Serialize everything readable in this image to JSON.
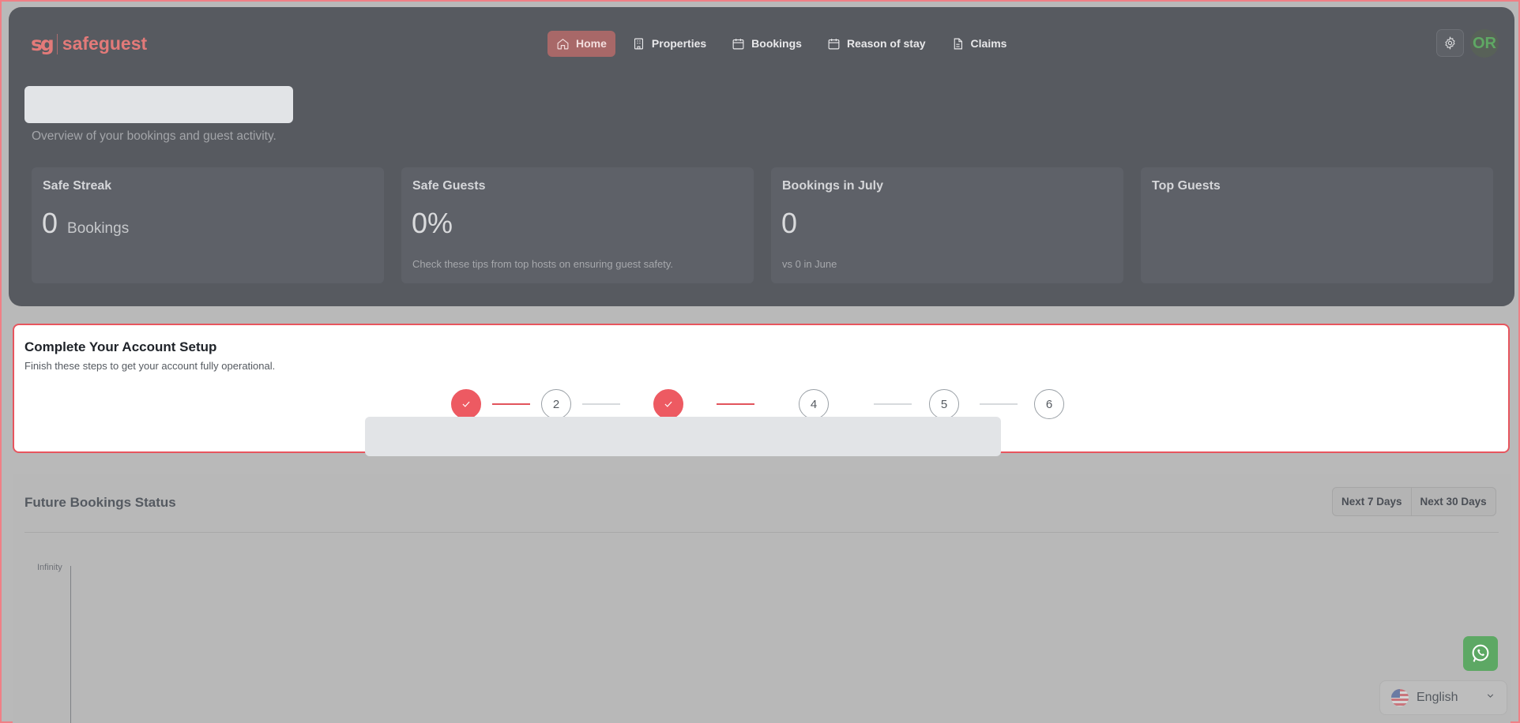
{
  "brand": {
    "name": "safeguest",
    "mark": "sg"
  },
  "nav": {
    "items": [
      {
        "label": "Home",
        "icon": "home-icon"
      },
      {
        "label": "Properties",
        "icon": "building-icon"
      },
      {
        "label": "Bookings",
        "icon": "calendar-icon"
      },
      {
        "label": "Reason of stay",
        "icon": "calendar-icon"
      },
      {
        "label": "Claims",
        "icon": "document-icon"
      }
    ]
  },
  "user": {
    "initials": "OR"
  },
  "page": {
    "subtitle": "Overview of your bookings and guest activity."
  },
  "stats": [
    {
      "title": "Safe Streak",
      "value": "0",
      "unit": "Bookings",
      "note": ""
    },
    {
      "title": "Safe Guests",
      "value": "0%",
      "unit": "",
      "note": "Check these tips from top hosts on ensuring guest safety."
    },
    {
      "title": "Bookings in July",
      "value": "0",
      "unit": "",
      "note": "vs 0 in June"
    },
    {
      "title": "Top Guests",
      "value": "",
      "unit": "",
      "note": ""
    }
  ],
  "setup": {
    "title": "Complete Your Account Setup",
    "subtitle": "Finish these steps to get your account fully operational.",
    "steps": [
      {
        "number": "1",
        "done": true
      },
      {
        "number": "2",
        "done": false
      },
      {
        "number": "3",
        "done": true
      },
      {
        "number": "4",
        "done": false
      },
      {
        "number": "5",
        "done": false
      },
      {
        "number": "6",
        "done": false
      }
    ]
  },
  "future": {
    "title": "Future Bookings Status",
    "range_options": [
      "Next 7 Days",
      "Next 30 Days"
    ],
    "y_axis_top_label": "Infinity"
  },
  "language": {
    "selected": "English"
  },
  "colors": {
    "accent": "#ed5a62",
    "whatsapp": "#5da864",
    "brand": "#e37a79"
  }
}
